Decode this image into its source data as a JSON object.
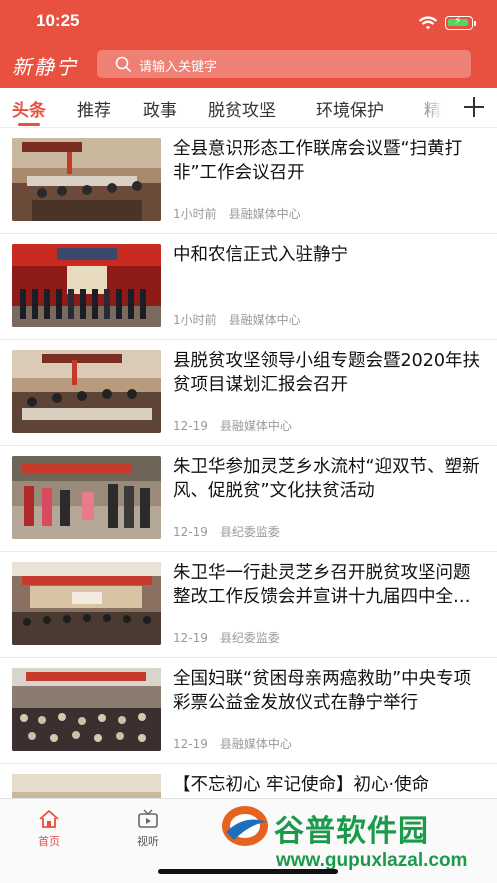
{
  "status_bar": {
    "time": "10:25"
  },
  "header": {
    "logo": "新静宁",
    "search_placeholder": "请输入关键字"
  },
  "tabs": [
    {
      "label": "头条",
      "active": true
    },
    {
      "label": "推荐"
    },
    {
      "label": "政事"
    },
    {
      "label": "脱贫攻坚"
    },
    {
      "label": "环境保护"
    },
    {
      "label": "精准"
    }
  ],
  "news": [
    {
      "title": "全县意识形态工作联席会议暨“扫黄打非”工作会议召开",
      "time": "1小时前",
      "source": "县融媒体中心"
    },
    {
      "title": "中和农信正式入驻静宁",
      "time": "1小时前",
      "source": "县融媒体中心"
    },
    {
      "title": "县脱贫攻坚领导小组专题会暨2020年扶贫项目谋划汇报会召开",
      "time": "12-19",
      "source": "县融媒体中心"
    },
    {
      "title": "朱卫华参加灵芝乡水流村“迎双节、塑新风、促脱贫”文化扶贫活动",
      "time": "12-19",
      "source": "县纪委监委"
    },
    {
      "title": "朱卫华一行赴灵芝乡召开脱贫攻坚问题整改工作反馈会并宣讲十九届四中全会精神",
      "time": "12-19",
      "source": "县纪委监委"
    },
    {
      "title": "全国妇联“贫困母亲两癌救助”中央专项彩票公益金发放仪式在静宁举行",
      "time": "12-19",
      "source": "县融媒体中心"
    },
    {
      "title": "【不忘初心 牢记使命】初心·使命",
      "time": "",
      "source": ""
    }
  ],
  "bottom_nav": [
    {
      "label": "首页",
      "active": true
    },
    {
      "label": "视听"
    }
  ],
  "watermark": {
    "name": "谷普软件园",
    "url": "www.gupuxlazal.com"
  },
  "colors": {
    "brand": "#e8503f",
    "watermark": "#1a9a4a"
  }
}
